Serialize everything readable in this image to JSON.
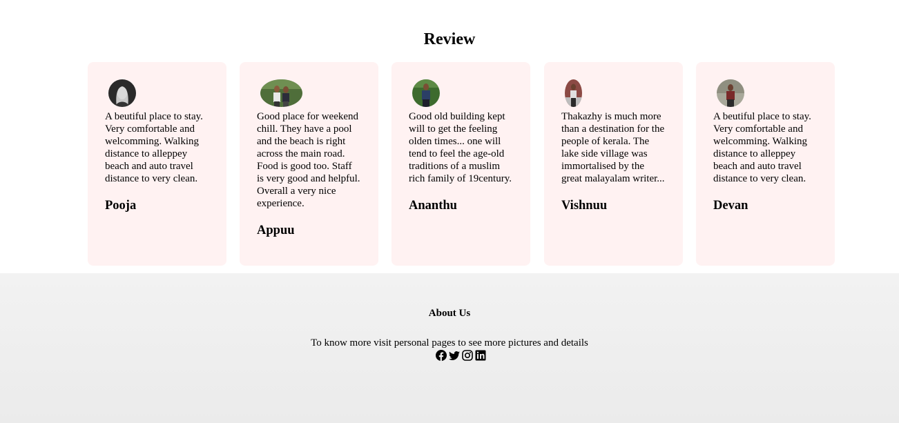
{
  "review": {
    "title": "Review",
    "cards": [
      {
        "text": "A beutiful place to stay. Very comfortable and welcomming. Walking distance to alleppey beach and auto travel distance to very clean.",
        "name": "Pooja"
      },
      {
        "text": "Good place for weekend chill. They have a pool and the beach is right across the main road. Food is good too. Staff is very good and helpful. Overall a very nice experience.",
        "name": "Appuu"
      },
      {
        "text": "Good old building kept will to get the feeling olden times... one will tend to feel the age-old traditions of a muslim rich family of 19century.",
        "name": "Ananthu"
      },
      {
        "text": "Thakazhy is much more than a destination for the people of kerala. The lake side village was immortalised by the great malayalam writer...",
        "name": "Vishnuu"
      },
      {
        "text": "A beutiful place to stay. Very comfortable and welcomming. Walking distance to alleppey beach and auto travel distance to very clean.",
        "name": "Devan"
      }
    ]
  },
  "footer": {
    "about_title": "About Us",
    "about_text": "To know more visit personal pages to see more pictures and details",
    "social_icons": [
      "facebook-icon",
      "twitter-icon",
      "instagram-icon",
      "linkedin-icon"
    ]
  },
  "colors": {
    "card_background": "#fff2f2",
    "footer_background": "#efefef"
  }
}
